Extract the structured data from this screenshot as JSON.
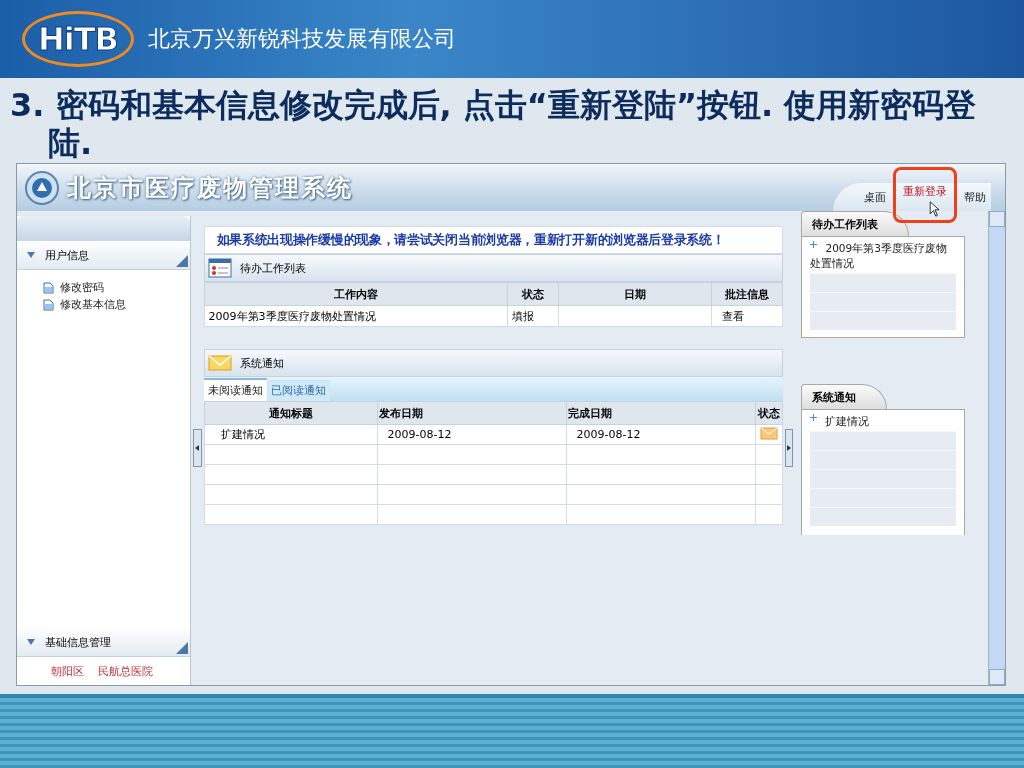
{
  "slide": {
    "logo": "HiTB",
    "company": "北京万兴新锐科技发展有限公司",
    "title": "3. 密码和基本信息修改完成后, 点击“重新登陆”按钮.  使用新密码登陆."
  },
  "app": {
    "title": "北京市医疗废物管理系统",
    "top_links": [
      {
        "label": "桌面",
        "highlighted": false
      },
      {
        "label": "重新登录",
        "highlighted": true
      },
      {
        "label": "帮助",
        "highlighted": false
      }
    ],
    "sidebar": {
      "sections": [
        {
          "label": "用户信息",
          "items": [
            "修改密码",
            "修改基本信息"
          ]
        },
        {
          "label": "基础信息管理"
        }
      ],
      "footer": [
        "朝阳区",
        "民航总医院"
      ]
    },
    "notice": "如果系统出现操作缓慢的现象，请尝试关闭当前浏览器，重新打开新的浏览器后登录系统！",
    "todo": {
      "title": "待办工作列表",
      "columns": [
        "工作内容",
        "状态",
        "日期",
        "批注信息"
      ],
      "rows": [
        [
          "2009年第3季度医疗废物处置情况",
          "填报",
          null,
          "查看"
        ]
      ]
    },
    "notifications": {
      "title": "系统通知",
      "tabs": [
        {
          "label": "未阅读通知",
          "selected": true
        },
        {
          "label": "已阅读通知",
          "selected": false
        }
      ],
      "columns": [
        "通知标题",
        "发布日期",
        "完成日期",
        "状态"
      ],
      "rows": [
        {
          "title": "扩建情况",
          "published": "2009-08-12",
          "completed": "2009-08-12"
        }
      ]
    },
    "widgets": [
      {
        "title": "待办工作列表",
        "items": [
          "2009年第3季度医疗废物处置情况"
        ]
      },
      {
        "title": "系统通知",
        "items": [
          "扩建情况"
        ]
      }
    ]
  }
}
